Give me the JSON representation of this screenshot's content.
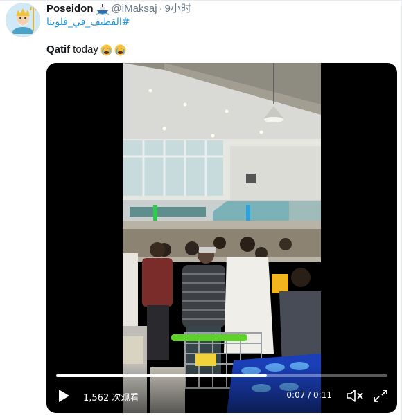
{
  "tweet": {
    "display_name": "Poseidon",
    "handle": "@iMaksaj",
    "separator": "·",
    "time": "9小时",
    "hashtag": "#القطيف_في_قلوبنا",
    "text_bold": "Qatif",
    "text_normal": "today",
    "emoji_name": "ship-emoji",
    "reaction_emojis": [
      "loudly-crying-face-emoji",
      "loudly-crying-face-emoji"
    ]
  },
  "video": {
    "view_count": "1,562 次观看",
    "time_display": "0:07 / 0:11",
    "progress": 0.636,
    "controls": [
      "play-icon",
      "mute-icon",
      "fullscreen-icon"
    ]
  },
  "colors": {
    "link": "#1b95e0",
    "secondary_text": "#657786",
    "video_bg": "#000000"
  }
}
